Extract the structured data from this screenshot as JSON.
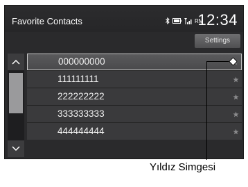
{
  "header": {
    "title": "Favorite Contacts",
    "status_text": "RM",
    "clock": "12:34"
  },
  "settings_button": "Settings",
  "contacts": [
    {
      "number": "000000000",
      "selected": true
    },
    {
      "number": "111111111",
      "selected": false
    },
    {
      "number": "222222222",
      "selected": false
    },
    {
      "number": "333333333",
      "selected": false
    },
    {
      "number": "444444444",
      "selected": false
    }
  ],
  "annotation": "Yıldız Simgesi",
  "icons": {
    "bluetooth": "bluetooth-icon",
    "battery": "battery-icon",
    "signal": "signal-icon",
    "star": "star-icon",
    "up": "chevron-up-icon",
    "down": "chevron-down-icon"
  },
  "colors": {
    "screen_bg": "#2a2a2c",
    "row_bg": "#3a3a3c",
    "selected_border": "#c8c8c8",
    "star": "#8a8a8c"
  }
}
